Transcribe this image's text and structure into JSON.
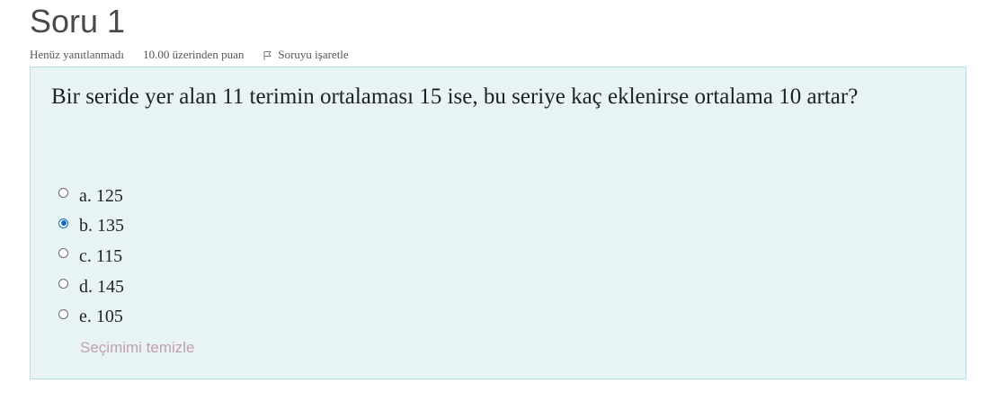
{
  "question": {
    "title": "Soru 1",
    "status": "Henüz yanıtlanmadı",
    "points": "10.00 üzerinden puan",
    "flag_label": "Soruyu işaretle",
    "text": "Bir seride yer alan 11 terimin ortalaması 15 ise, bu seriye kaç eklenirse ortalama 10 artar?",
    "options": [
      {
        "label": "a. 125",
        "selected": false
      },
      {
        "label": "b. 135",
        "selected": true
      },
      {
        "label": "c. 115",
        "selected": false
      },
      {
        "label": "d. 145",
        "selected": false
      },
      {
        "label": "e. 105",
        "selected": false
      }
    ],
    "clear_label": "Seçimimi temizle"
  },
  "colors": {
    "panel_background": "#e7f3f5",
    "panel_border": "#b8dce2",
    "radio_selected": "#0f6cbf",
    "clear_link": "#c0a0b0"
  },
  "icons": {
    "flag": "flag-icon"
  }
}
